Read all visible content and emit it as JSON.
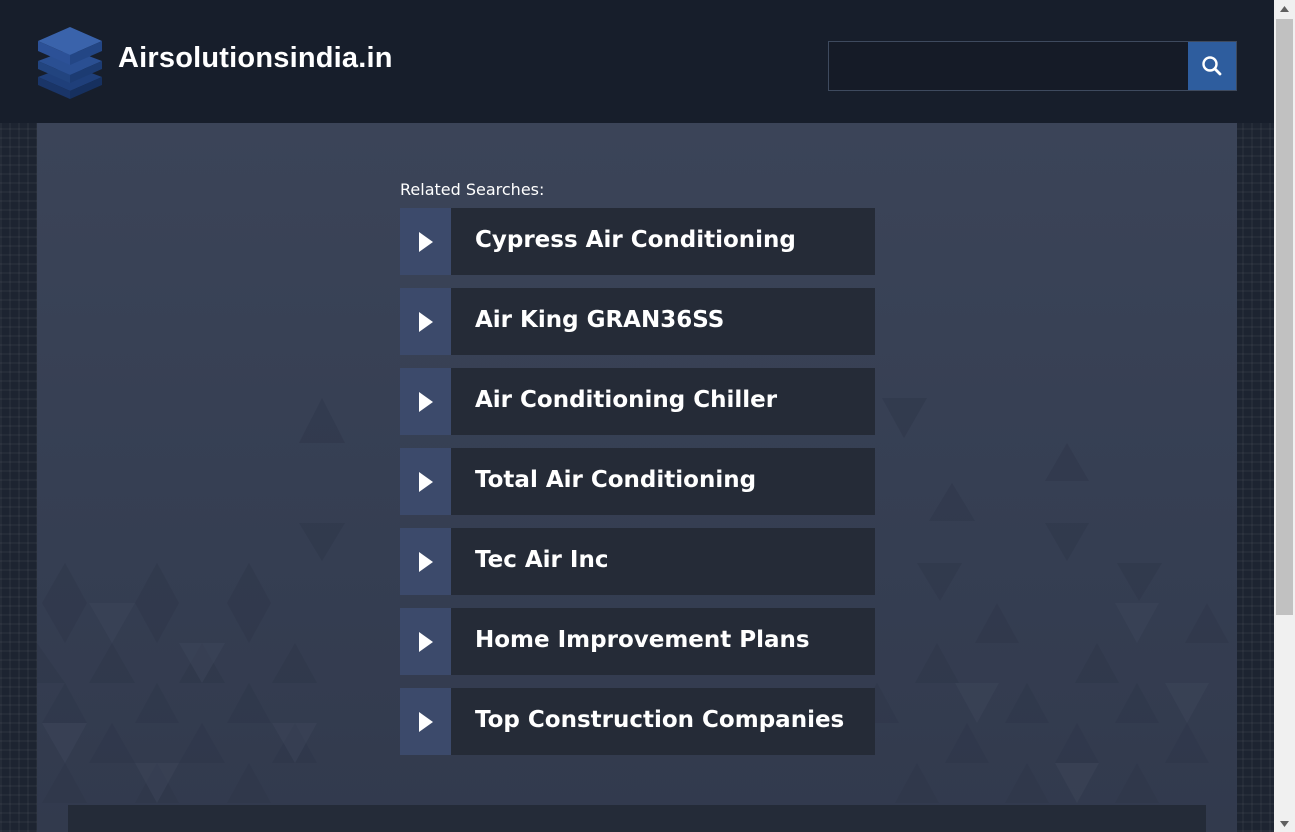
{
  "header": {
    "site_title": "Airsolutionsindia.in",
    "search": {
      "value": "",
      "placeholder": ""
    }
  },
  "related": {
    "label": "Related Searches:",
    "items": [
      {
        "label": "Cypress Air Conditioning"
      },
      {
        "label": "Air King GRAN36SS"
      },
      {
        "label": "Air Conditioning Chiller"
      },
      {
        "label": "Total Air Conditioning"
      },
      {
        "label": "Tec Air Inc"
      },
      {
        "label": "Home Improvement Plans"
      },
      {
        "label": "Top Construction Companies"
      }
    ]
  },
  "colors": {
    "header_bg": "#171e2b",
    "accent": "#2e5d9e",
    "item_bg": "#252b37",
    "arrow_bg": "#3c4a6b"
  },
  "icons": {
    "logo": "stacked-layers-icon",
    "search": "search-icon",
    "item_arrow": "play-arrow-icon"
  }
}
